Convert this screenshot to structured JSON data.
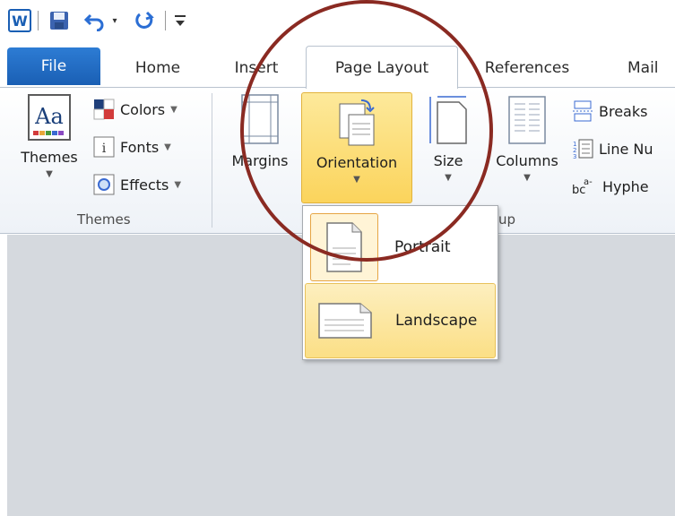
{
  "quick_access": {
    "app_icon": "word-icon",
    "save_icon": "save-icon",
    "undo_icon": "undo-icon",
    "redo_icon": "redo-icon",
    "customize_icon": "customize-qat-icon"
  },
  "tabs": [
    {
      "label": "File"
    },
    {
      "label": "Home"
    },
    {
      "label": "Insert"
    },
    {
      "label": "Page Layout"
    },
    {
      "label": "References"
    },
    {
      "label": "Mail"
    }
  ],
  "ribbon": {
    "themes_group": {
      "themes_label": "Themes",
      "colors_label": "Colors",
      "fonts_label": "Fonts",
      "effects_label": "Effects",
      "group_label": "Themes"
    },
    "page_setup_group": {
      "margins_label": "Margins",
      "orientation_label": "Orientation",
      "size_label": "Size",
      "columns_label": "Columns",
      "breaks_label": "Breaks",
      "line_numbers_label": "Line Nu",
      "hyphenation_label": "Hyphe",
      "group_label_partial": "up"
    }
  },
  "orientation_menu": {
    "items": [
      {
        "label": "Portrait",
        "icon": "portrait-page-icon"
      },
      {
        "label": "Landscape",
        "icon": "landscape-page-icon"
      }
    ]
  },
  "colors": {
    "file_tab": "#1a5fb4",
    "highlight": "#fbd45c",
    "annotation": "#8a2a22",
    "doc_background": "#d5d9de"
  }
}
